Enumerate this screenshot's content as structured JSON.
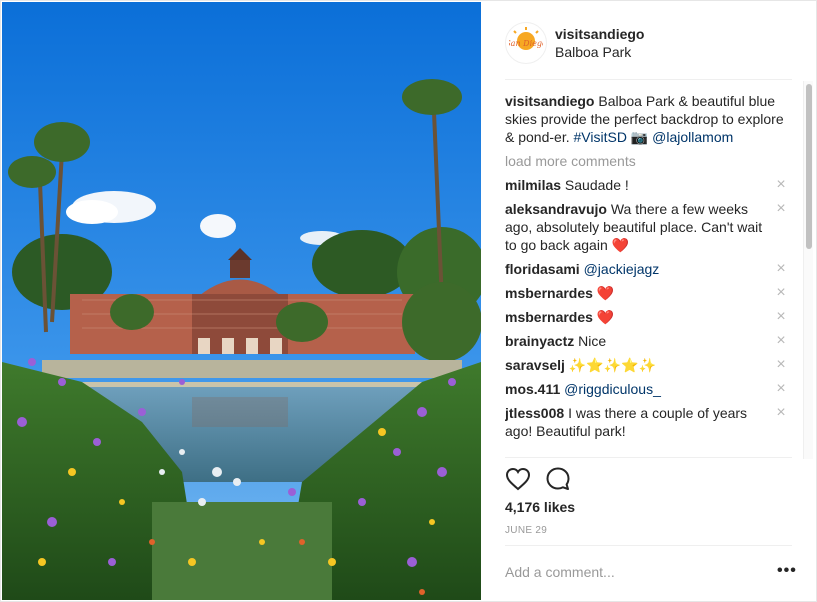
{
  "post": {
    "username": "visitsandiego",
    "location": "Balboa Park",
    "avatar_label": "San Diego",
    "caption": {
      "username": "visitsandiego",
      "text": "Balboa Park & beautiful blue skies provide the perfect backdrop to explore & pond-er.",
      "hashtag": "#VisitSD",
      "emoji": "📷",
      "mention": "@lajollamom"
    },
    "load_more_label": "load more comments",
    "comments": [
      {
        "user": "milmilas",
        "text": "Saudade !"
      },
      {
        "user": "aleksandravujo",
        "text": "Wa there a few weeks ago, absolutely beautiful place. Can't wait to go back again",
        "emoji": "❤️"
      },
      {
        "user": "floridasami",
        "mention": "@jackiejagz"
      },
      {
        "user": "msbernardes",
        "emoji": "❤️"
      },
      {
        "user": "msbernardes",
        "emoji": "❤️"
      },
      {
        "user": "brainyactz",
        "text": "Nice"
      },
      {
        "user": "saravselj",
        "emoji": "✨⭐✨⭐✨"
      },
      {
        "user": "mos.411",
        "mention": "@riggdiculous_"
      },
      {
        "user": "jtless008",
        "text": "I was there a couple of years ago! Beautiful park!"
      }
    ],
    "delete_icon": "×",
    "likes": "4,176 likes",
    "date": "JUNE 29",
    "add_comment_placeholder": "Add a comment...",
    "more_label": "•••"
  },
  "colors": {
    "link": "#003569",
    "muted": "#999999",
    "border": "#efefef",
    "heart": "#ed4956"
  },
  "icons": [
    "like-heart-icon",
    "comment-bubble-icon",
    "delete-comment-icon",
    "more-options-icon"
  ]
}
